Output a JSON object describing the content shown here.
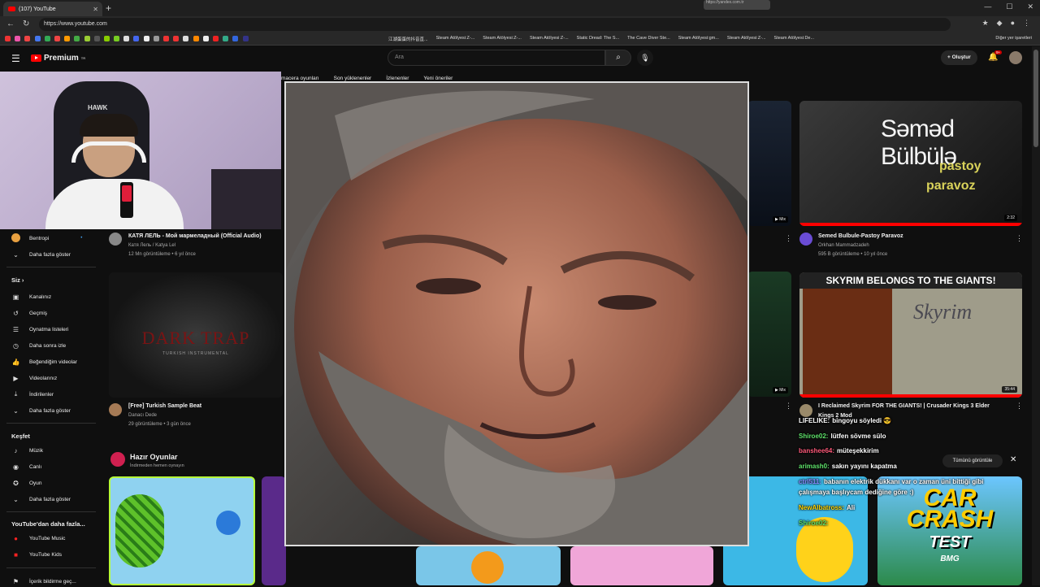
{
  "browser": {
    "tab_title": "(107) YouTube",
    "url": "https://www.youtube.com",
    "url_popup": "https://yandex.com.tr",
    "bookmarks": [
      "江湖蛋蛋的抖音直...",
      "Steam AtölyesiːZ-...",
      "Steam AtölyesiːZ-...",
      "Steam AtölyesiːZ-...",
      "Static Dread: The S...",
      "The Cave Diver Ste...",
      "Steam Atölyesi:gm...",
      "Steam AtölyesiːZ-...",
      "Steam AtölyesiːDe..."
    ],
    "other_bookmarks": "Diğer yer işaretleri"
  },
  "header": {
    "logo_text": "Premium",
    "logo_sup": "TR",
    "search_placeholder": "Ara",
    "create_label": "Oluştur",
    "notif_count": "9+"
  },
  "chips": [
    "macera oyunları",
    "Son yüklenenler",
    "İzlenenler",
    "Yeni öneriler"
  ],
  "sidebar": {
    "sub_item": "Bentropi",
    "more1": "Daha fazla göster",
    "you_head": "Siz",
    "you_items": [
      "Kanalınız",
      "Geçmiş",
      "Oynatma listeleri",
      "Daha sonra izle",
      "Beğendiğim videolar",
      "Videolarınız",
      "İndirilenler",
      "Daha fazla göster"
    ],
    "explore_head": "Keşfet",
    "explore_items": [
      "Müzik",
      "Canlı",
      "Oyun",
      "Daha fazla göster"
    ],
    "more_head": "YouTube'dan daha fazla...",
    "more_items": [
      "YouTube Music",
      "YouTube Kids"
    ],
    "footer_item": "İçerik bildirme geç..."
  },
  "videos": {
    "v1": {
      "title": "КАТЯ ЛЕЛЬ - Мой мармеладный (Official Audio)",
      "channel": "Катя Лель / Katya Lel",
      "stats": "12 Mn görüntüleme • 6 yıl önce"
    },
    "v2": {
      "title": "[Free] Turkish Sample Beat",
      "channel": "Danacı Dede",
      "stats": "29 görüntüleme • 3 gün önce",
      "thumb_text": "DARK TRAP",
      "thumb_sub": "TURKISH INSTRUMENTAL"
    },
    "v3": {
      "title": "Semed Bulbule-Pastoy Paravoz",
      "channel": "Orkhan Mammadzadeh",
      "stats": "595 B görüntüleme • 10 yıl önce",
      "duration": "2:32",
      "thumb_title": "Səməd Bülbülə",
      "thumb_sub1": "pastoy",
      "thumb_sub2": "paravoz"
    },
    "v4": {
      "title": "I Reclaimed Skyrim FOR THE GIANTS! | Crusader Kings 3 Elder",
      "title2": "Kings 2 Mod",
      "duration": "35:44",
      "thumb_banner": "SKYRIM BELONGS TO THE GIANTS!",
      "thumb_map": "Skyrim"
    },
    "mix_label": "Mix"
  },
  "games": {
    "heading": "Hazır Oyunlar",
    "sub": "İndirmeden hemen oynayın",
    "car_crash_line1": "CAR",
    "car_crash_line2": "CRASH",
    "car_crash_line3": "TEST",
    "car_crash_line4": "BMG"
  },
  "chat": [
    {
      "user": "LIFELIKE:",
      "msg": "bingoyu söyledi",
      "color": "#ffffff"
    },
    {
      "user": "Shiroe02:",
      "msg": "lütfen sövme sülo",
      "color": "#5fe36b"
    },
    {
      "user": "banshee64:",
      "msg": "müteşekkirim",
      "color": "#ff5a7a"
    },
    {
      "user": "arimash0:",
      "msg": "sakın yayını kapatma",
      "color": "#5fe36b"
    },
    {
      "user": "ctrl511:",
      "msg": "babanın elektrik dükkanı var o zaman üni bittiği gibi",
      "color": "#8888ff"
    },
    {
      "user": "",
      "msg": "çalışmaya başlıycam dediğine göre :)",
      "color": "#ffffff"
    },
    {
      "user": "NewAlbatross:",
      "msg": "Ali",
      "color": "#ffd400"
    },
    {
      "user": "Shiroe02:",
      "msg": "",
      "color": "#5fe36b"
    }
  ],
  "chat_show_all": "Tümünü görüntüle"
}
